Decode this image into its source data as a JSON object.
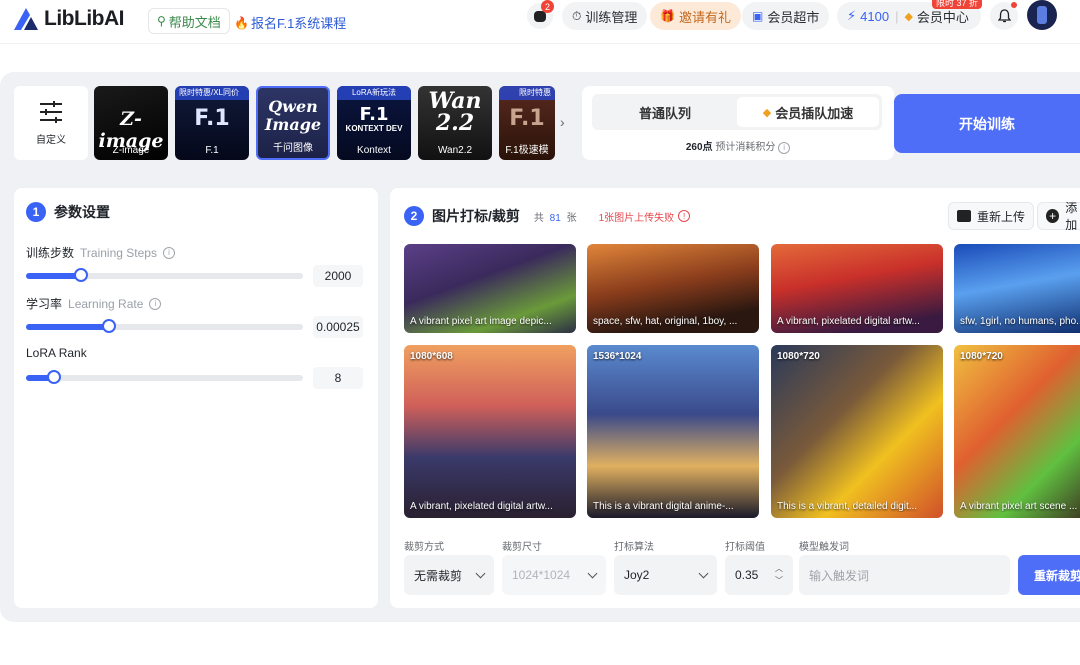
{
  "header": {
    "logo_text": "LibLibAI",
    "help_label": "帮助文档",
    "course_label": "报名F.1系统课程",
    "notif_count": "2",
    "train_manage": "训练管理",
    "invite": "邀请有礼",
    "vip_market": "会员超市",
    "points": "4100",
    "vip_center": "会员中心",
    "discount_tag": "限时 37 折"
  },
  "presets": [
    {
      "label": "自定义"
    },
    {
      "label": "Z-image",
      "big": "Z-image"
    },
    {
      "label": "F.1",
      "big": "F.1",
      "tag": "限时特惠/XL同价"
    },
    {
      "label": "千问图像",
      "big": "Qwen Image"
    },
    {
      "label": "Kontext",
      "big": "F.1",
      "sub": "KONTEXT DEV",
      "tag": "LoRA新玩法"
    },
    {
      "label": "Wan2.2",
      "big": "Wan 2.2"
    },
    {
      "label": "F.1极速模",
      "big": "F.1",
      "tag": "限时特惠"
    }
  ],
  "queue": {
    "normal": "普通队列",
    "vip": "会员插队加速",
    "cost_points": "260点",
    "cost_label": "预计消耗积分"
  },
  "start_label": "开始训练",
  "params": {
    "step_num": "1",
    "title": "参数设置",
    "steps_label": "训练步数",
    "steps_en": "Training Steps",
    "steps_value": "2000",
    "steps_fraction": 0.2,
    "lr_label": "学习率",
    "lr_en": "Learning Rate",
    "lr_value": "0.00025",
    "lr_fraction": 0.3,
    "rank_label": "LoRA Rank",
    "rank_value": "8",
    "rank_fraction": 0.1
  },
  "images": {
    "step_num": "2",
    "title": "图片打标/裁剪",
    "count_prefix": "共",
    "count": "81",
    "count_suffix": "张",
    "fail_msg": "1张图片上传失败",
    "reupload": "重新上传",
    "add": "添加",
    "thumbs_row1": [
      {
        "caption": "A vibrant pixel art image depic..."
      },
      {
        "caption": "space, sfw, hat, original, 1boy, ..."
      },
      {
        "caption": "A vibrant, pixelated digital artw..."
      },
      {
        "caption": "sfw, 1girl, no humans, pho..."
      }
    ],
    "thumbs_row2": [
      {
        "dim": "1080*608",
        "caption": "A vibrant, pixelated digital artw..."
      },
      {
        "dim": "1536*1024",
        "caption": "This is a vibrant digital anime-..."
      },
      {
        "dim": "1080*720",
        "caption": "This is a vibrant, detailed digit..."
      },
      {
        "dim": "1080*720",
        "caption": "A vibrant pixel art scene ..."
      }
    ]
  },
  "footer": {
    "crop_method_label": "裁剪方式",
    "crop_method": "无需裁剪",
    "crop_size_label": "裁剪尺寸",
    "crop_size": "1024*1024",
    "tag_algo_label": "打标算法",
    "tag_algo": "Joy2",
    "threshold_label": "打标阈值",
    "threshold": "0.35",
    "trigger_label": "模型触发词",
    "trigger_placeholder": "输入触发词",
    "recrop": "重新裁剪"
  }
}
